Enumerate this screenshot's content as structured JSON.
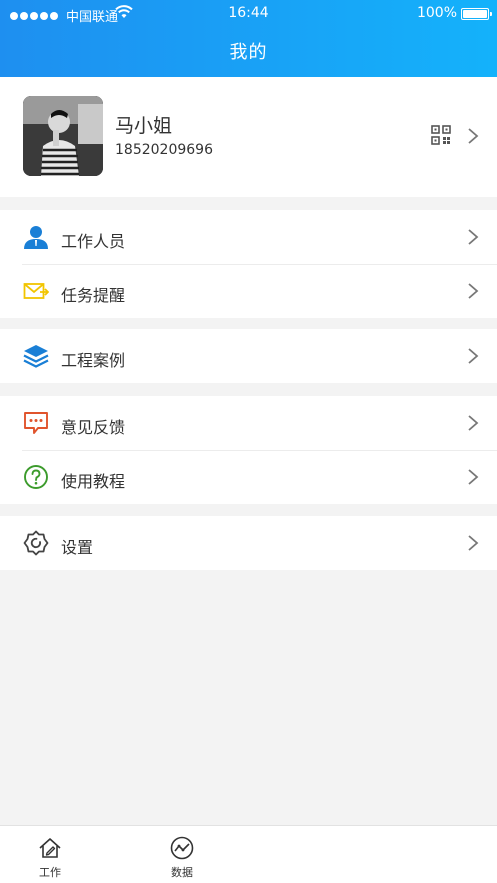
{
  "status_bar": {
    "carrier": "中国联通",
    "time": "16:44",
    "battery": "100%"
  },
  "header": {
    "title": "我的"
  },
  "profile": {
    "name": "马小姐",
    "phone": "18520209696"
  },
  "menu": {
    "group1": [
      {
        "label": "工作人员",
        "icon": "person-icon"
      },
      {
        "label": "任务提醒",
        "icon": "mail-icon"
      }
    ],
    "group2": [
      {
        "label": "工程案例",
        "icon": "layers-icon"
      }
    ],
    "group3": [
      {
        "label": "意见反馈",
        "icon": "chat-icon"
      },
      {
        "label": "使用教程",
        "icon": "help-icon"
      }
    ],
    "group4": [
      {
        "label": "设置",
        "icon": "gear-icon"
      }
    ]
  },
  "tabs": [
    {
      "label": "工作"
    },
    {
      "label": "数据"
    }
  ],
  "colors": {
    "header_start": "#1e8ff0",
    "header_end": "#14b2fb",
    "accent_blue": "#1a7fd6",
    "accent_yellow": "#f2c500",
    "accent_red": "#e0542d",
    "accent_green": "#3c9b2c"
  }
}
